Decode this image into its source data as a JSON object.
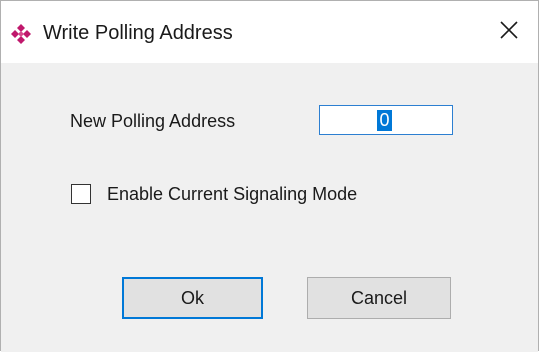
{
  "window": {
    "title": "Write Polling Address",
    "icon": "diamond-grid-icon",
    "icon_color": "#c0186c",
    "close_icon": "close-icon"
  },
  "form": {
    "address_label": "New Polling Address",
    "address_value": "0",
    "checkbox_label": "Enable Current Signaling Mode",
    "checkbox_checked": false
  },
  "buttons": {
    "ok_label": "Ok",
    "cancel_label": "Cancel"
  },
  "colors": {
    "accent": "#0078d7",
    "dialog_background": "#f0f0f0",
    "button_face": "#e1e1e1"
  }
}
